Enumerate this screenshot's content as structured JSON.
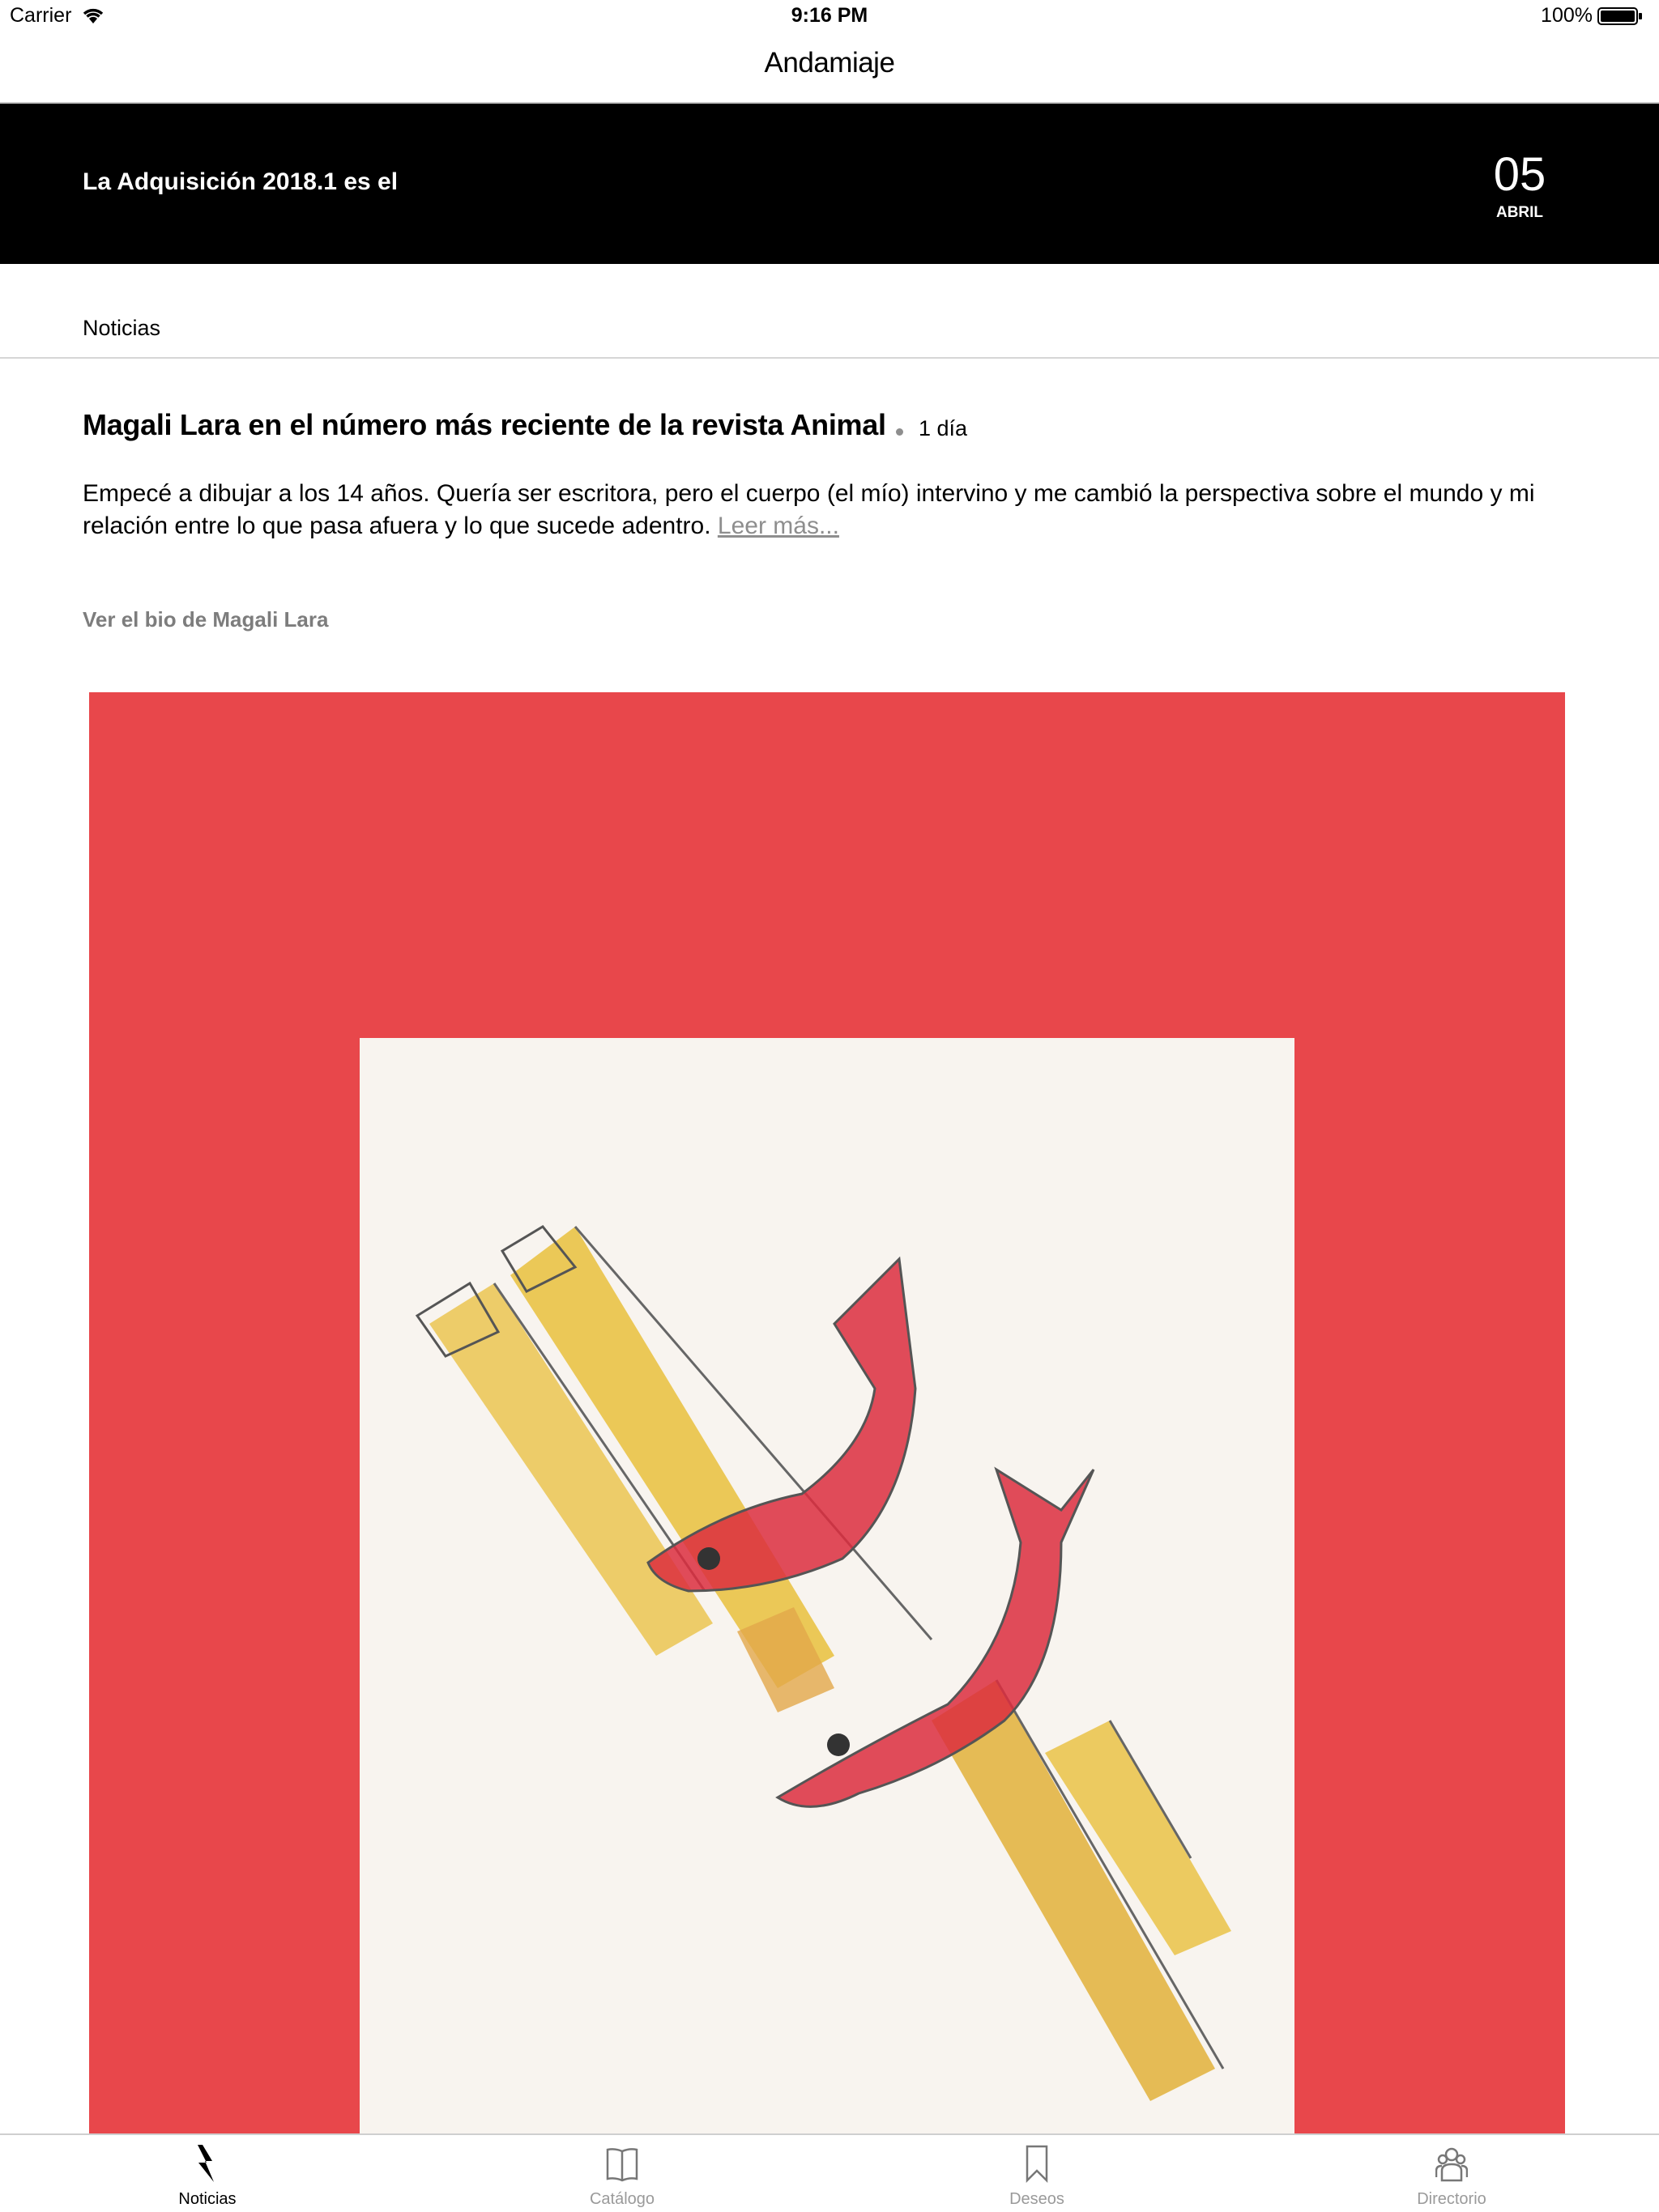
{
  "status_bar": {
    "carrier": "Carrier",
    "time": "9:16 PM",
    "battery": "100%"
  },
  "nav": {
    "title": "Andamiaje"
  },
  "banner": {
    "headline": "La Adquisición 2018.1 es el",
    "day": "05",
    "month": "ABRIL"
  },
  "section": {
    "title": "Noticias"
  },
  "article": {
    "title": "Magali Lara en el número más reciente de la revista Animal",
    "age": "1 día",
    "body": "Empecé a dibujar a los 14 años. Quería ser escritora, pero el cuerpo (el mío) intervino y me cambió la perspectiva sobre el mundo y mi relación entre lo que pasa afuera y lo que sucede adentro.",
    "read_more": "Leer más...",
    "bio_link": "Ver el bio de Magali Lara"
  },
  "artwork": {
    "background_color": "#e8474b",
    "paper_color": "#f8f4ef",
    "description_icon": "fish-drawing"
  },
  "tab_bar": {
    "tabs": [
      {
        "label": "Noticias",
        "icon": "lightning-icon",
        "active": true
      },
      {
        "label": "Catálogo",
        "icon": "book-icon",
        "active": false
      },
      {
        "label": "Deseos",
        "icon": "bookmark-icon",
        "active": false
      },
      {
        "label": "Directorio",
        "icon": "people-icon",
        "active": false
      }
    ]
  }
}
